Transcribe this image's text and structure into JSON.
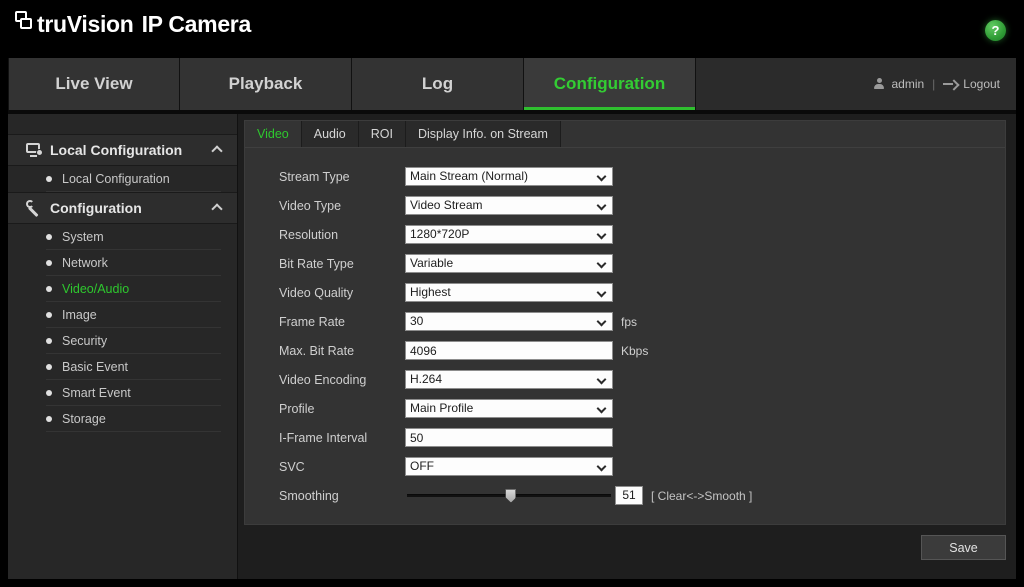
{
  "brand": {
    "name_primary": "truVision",
    "name_secondary": "IP Camera",
    "logo_icon": "stacked-squares-icon",
    "help_icon": "question-mark-icon",
    "help_label": "?"
  },
  "mainnav": {
    "tabs": [
      {
        "label": "Live View",
        "active": false
      },
      {
        "label": "Playback",
        "active": false
      },
      {
        "label": "Log",
        "active": false
      },
      {
        "label": "Configuration",
        "active": true
      }
    ],
    "user": {
      "name": "admin",
      "separator": "|",
      "logout_label": "Logout",
      "person_icon": "person-icon",
      "logout_icon": "logout-arrow-icon"
    },
    "accent_green": "#2fbf2f"
  },
  "sidebar": {
    "groups": [
      {
        "title": "Local Configuration",
        "icon": "monitor-gear-icon",
        "collapse_icon": "chevron-up-icon",
        "expanded": true,
        "items": [
          {
            "label": "Local Configuration",
            "active": false
          }
        ]
      },
      {
        "title": "Configuration",
        "icon": "wrench-icon",
        "collapse_icon": "chevron-up-icon",
        "expanded": true,
        "items": [
          {
            "label": "System",
            "active": false
          },
          {
            "label": "Network",
            "active": false
          },
          {
            "label": "Video/Audio",
            "active": true
          },
          {
            "label": "Image",
            "active": false
          },
          {
            "label": "Security",
            "active": false
          },
          {
            "label": "Basic Event",
            "active": false
          },
          {
            "label": "Smart Event",
            "active": false
          },
          {
            "label": "Storage",
            "active": false
          }
        ]
      }
    ]
  },
  "content": {
    "tabs": [
      {
        "label": "Video",
        "active": true
      },
      {
        "label": "Audio",
        "active": false
      },
      {
        "label": "ROI",
        "active": false
      },
      {
        "label": "Display Info. on Stream",
        "active": false
      }
    ],
    "fields": {
      "stream_type": {
        "label": "Stream Type",
        "value": "Main Stream (Normal)",
        "type": "select"
      },
      "video_type": {
        "label": "Video Type",
        "value": "Video Stream",
        "type": "select"
      },
      "resolution": {
        "label": "Resolution",
        "value": "1280*720P",
        "type": "select"
      },
      "bit_rate_type": {
        "label": "Bit Rate Type",
        "value": "Variable",
        "type": "select"
      },
      "video_quality": {
        "label": "Video Quality",
        "value": "Highest",
        "type": "select"
      },
      "frame_rate": {
        "label": "Frame Rate",
        "value": "30",
        "type": "select",
        "unit": "fps"
      },
      "max_bit_rate": {
        "label": "Max. Bit Rate",
        "value": "4096",
        "type": "text",
        "unit": "Kbps"
      },
      "video_encoding": {
        "label": "Video Encoding",
        "value": "H.264",
        "type": "select"
      },
      "profile": {
        "label": "Profile",
        "value": "Main Profile",
        "type": "select"
      },
      "iframe_interval": {
        "label": "I-Frame Interval",
        "value": "50",
        "type": "text"
      },
      "svc": {
        "label": "SVC",
        "value": "OFF",
        "type": "select"
      },
      "smoothing": {
        "label": "Smoothing",
        "value": "51",
        "type": "slider",
        "hint": "[ Clear<->Smooth ]",
        "min": 0,
        "max": 100
      }
    },
    "save_label": "Save"
  }
}
